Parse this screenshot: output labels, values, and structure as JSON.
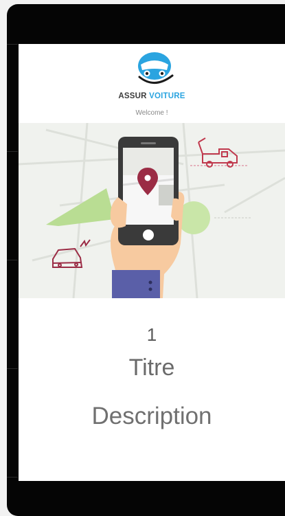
{
  "header": {
    "brand_part1": "ASSUR",
    "brand_part2": "VOITURE",
    "welcome": "Welcome !"
  },
  "slide": {
    "number": "1",
    "title": "Titre",
    "description": "Description"
  },
  "colors": {
    "accent_blue": "#2aa4e0",
    "pin_red": "#9b2c45",
    "map_green": "#b9dd93",
    "sleeve": "#5a5fa8"
  }
}
